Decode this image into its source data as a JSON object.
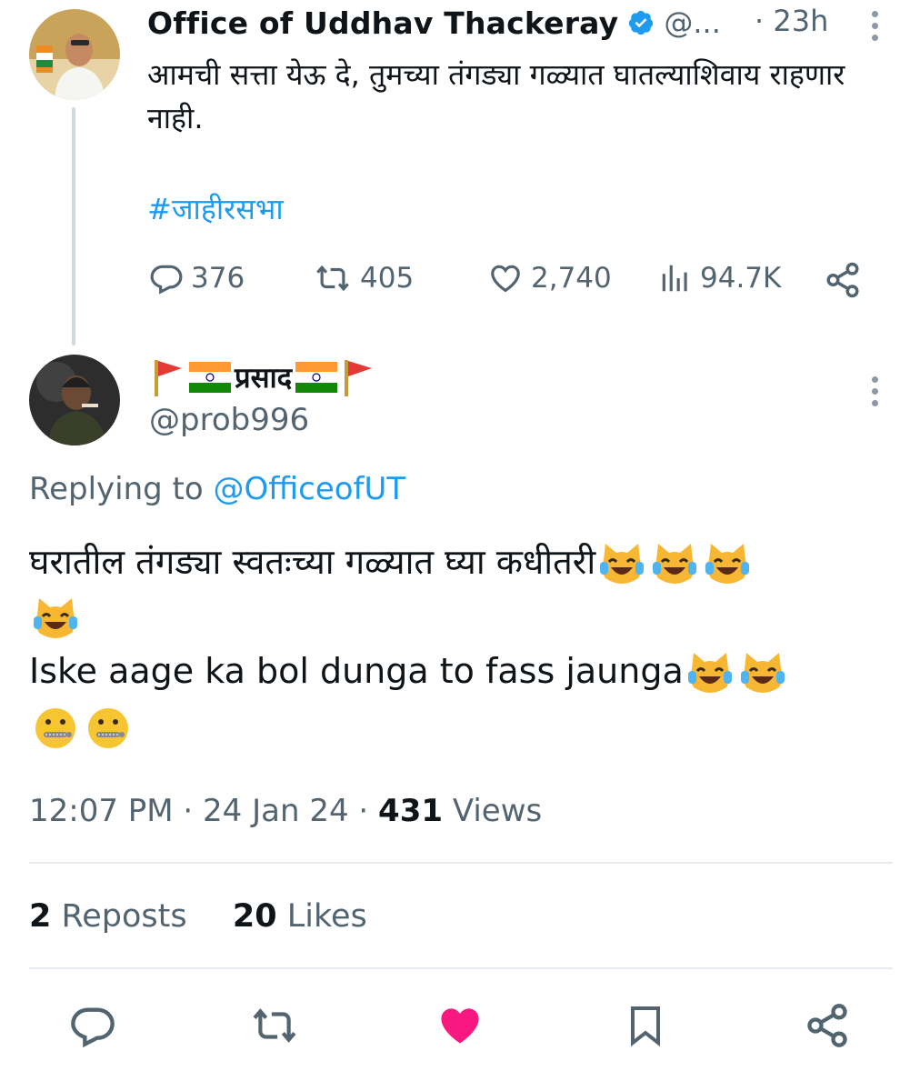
{
  "parent_tweet": {
    "display_name": "Office of Uddhav Thackeray",
    "handle_truncated": "@...",
    "time_ago": "· 23h",
    "text": "आमची सत्ता येऊ दे, तुमच्या तंगड्या गळ्यात घातल्याशिवाय राहणार नाही.",
    "hashtag": "#जाहीरसभा",
    "replies": "376",
    "reposts": "405",
    "likes": "2,740",
    "views": "94.7K"
  },
  "reply": {
    "display_name": "प्रसाद",
    "handle": "@prob996",
    "replying_prefix": "Replying to ",
    "replying_handle": "@OfficeofUT",
    "line1": "घरातील तंगड्या स्वतःच्या गळ्यात घ्या कधीतरी",
    "line2": "Iske aage ka bol dunga to fass jaunga",
    "time": "12:07 PM · 24 Jan 24 · ",
    "views_count": "431",
    "views_label": " Views",
    "reposts_count": "2",
    "reposts_label": " Reposts",
    "likes_count": "20",
    "likes_label": " Likes"
  },
  "colors": {
    "accent": "#1d9bf0",
    "liked": "#f91880",
    "muted": "#536471"
  },
  "icons": [
    "verified-badge-icon",
    "more-icon",
    "reply-icon",
    "repost-icon",
    "like-icon",
    "views-icon",
    "share-icon",
    "bookmark-icon",
    "flag-icon",
    "india-flag-icon",
    "cat-laughing-emoji",
    "zipper-mouth-emoji"
  ]
}
